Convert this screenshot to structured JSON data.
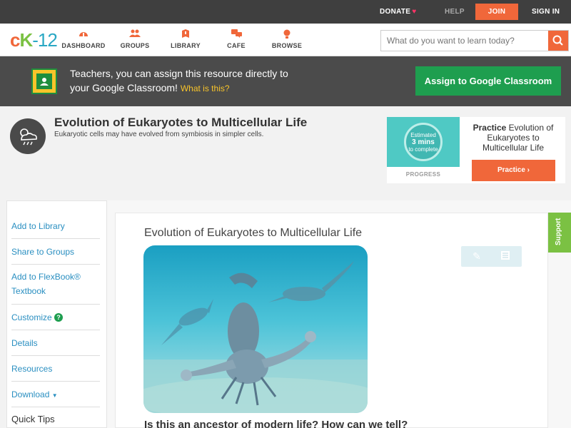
{
  "topbar": {
    "donate": "DONATE",
    "help": "HELP",
    "join": "JOIN",
    "sign_in": "SIGN IN"
  },
  "logo": {
    "c": "c",
    "k": "K",
    "rest": "-12"
  },
  "nav": [
    {
      "label": "DASHBOARD",
      "icon": "dashboard-icon"
    },
    {
      "label": "GROUPS",
      "icon": "groups-icon"
    },
    {
      "label": "LIBRARY",
      "icon": "library-icon"
    },
    {
      "label": "CAFE",
      "icon": "cafe-icon"
    },
    {
      "label": "BROWSE",
      "icon": "browse-icon"
    }
  ],
  "search": {
    "placeholder": "What do you want to learn today?"
  },
  "teacher_bar": {
    "line1": "Teachers, you can assign this resource directly to",
    "line2": "your Google Classroom!",
    "what_is_this": "What is this?",
    "assign_button": "Assign to Google Classroom"
  },
  "page": {
    "title": "Evolution of Eukaryotes to Multicellular Life",
    "subtitle": "Eukaryotic cells may have evolved from symbiosis in simpler cells."
  },
  "practice_card": {
    "estimated": "Estimated",
    "mins": "3 mins",
    "to_complete": "to complete",
    "progress": "PROGRESS",
    "practice_bold": "Practice",
    "practice_title": "Evolution of Eukaryotes to Multicellular Life",
    "button": "Practice"
  },
  "sidebar": {
    "items": [
      {
        "label": "Add to Library"
      },
      {
        "label": "Share to Groups"
      },
      {
        "label": "Add to FlexBook® Textbook"
      },
      {
        "label": "Customize"
      },
      {
        "label": "Details"
      },
      {
        "label": "Resources"
      },
      {
        "label": "Download"
      }
    ],
    "quick_tips": "Quick Tips"
  },
  "content": {
    "title": "Evolution of Eukaryotes to Multicellular Life",
    "question": "Is this an ancestor of modern life? How can we tell?"
  },
  "support": "Support",
  "colors": {
    "accent": "#f0673a",
    "green": "#1e9e4f",
    "link": "#2a8fc1",
    "dark": "#4b4b4b"
  }
}
